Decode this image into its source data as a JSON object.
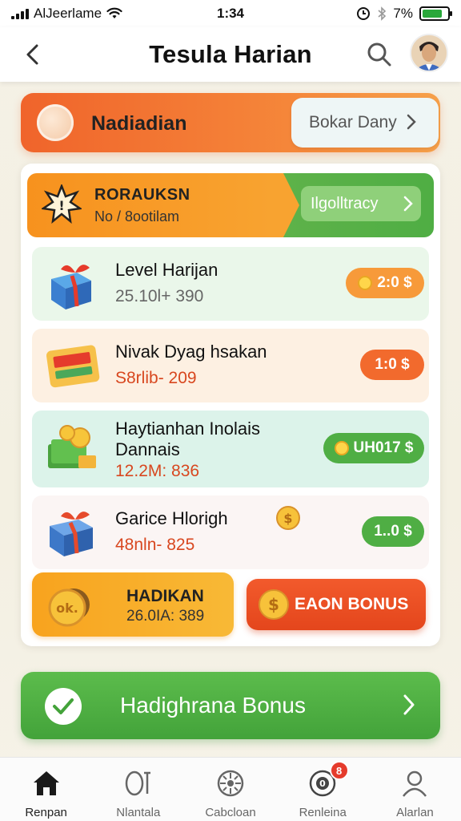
{
  "status_bar": {
    "carrier": "AlJeerlame",
    "time": "1:34",
    "battery_percent": "7%",
    "battery_level": 0.8
  },
  "header": {
    "title": "Tesula Harian"
  },
  "top_banner": {
    "title": "Nadiadian",
    "cta_label": "Bokar Dany"
  },
  "promo": {
    "title": "RORAUKSN",
    "subtitle": "No / 8ootilam",
    "button_label": "Ilgolltracy"
  },
  "tasks": [
    {
      "title": "Level Harijan",
      "sub": "25.10l+ 390",
      "reward": "2:0 $",
      "pill_color": "#f79a3a"
    },
    {
      "title": "Nivak Dyag hsakan",
      "sub": "S8rlib- 209",
      "reward": "1:0 $",
      "pill_color": "#f26a2d"
    },
    {
      "title_line1": "Haytianhan Inolais",
      "title_line2": "Dannais",
      "sub": "12.2M: 836",
      "reward": "UH017 $",
      "pill_color": "#4fae44"
    },
    {
      "title": "Garice Hlorigh",
      "sub": "48nln- 825",
      "reward": "1..0 $",
      "pill_color": "#4fae44"
    }
  ],
  "bottom_left": {
    "title": "HADIKAN",
    "sub": "26.0IA: 389",
    "coin_text": "ok."
  },
  "bottom_right": {
    "label": "EAON BONUS"
  },
  "big_cta": {
    "label": "Hadighrana Bonus"
  },
  "nav": {
    "items": [
      {
        "label": "Renpan",
        "icon": "home-icon"
      },
      {
        "label": "Nlantala",
        "icon": "tasks-icon"
      },
      {
        "label": "Cabcloan",
        "icon": "wheel-icon"
      },
      {
        "label": "Renleina",
        "icon": "bonus-icon",
        "badge": "8"
      },
      {
        "label": "Alarlan",
        "icon": "profile-icon"
      }
    ]
  }
}
